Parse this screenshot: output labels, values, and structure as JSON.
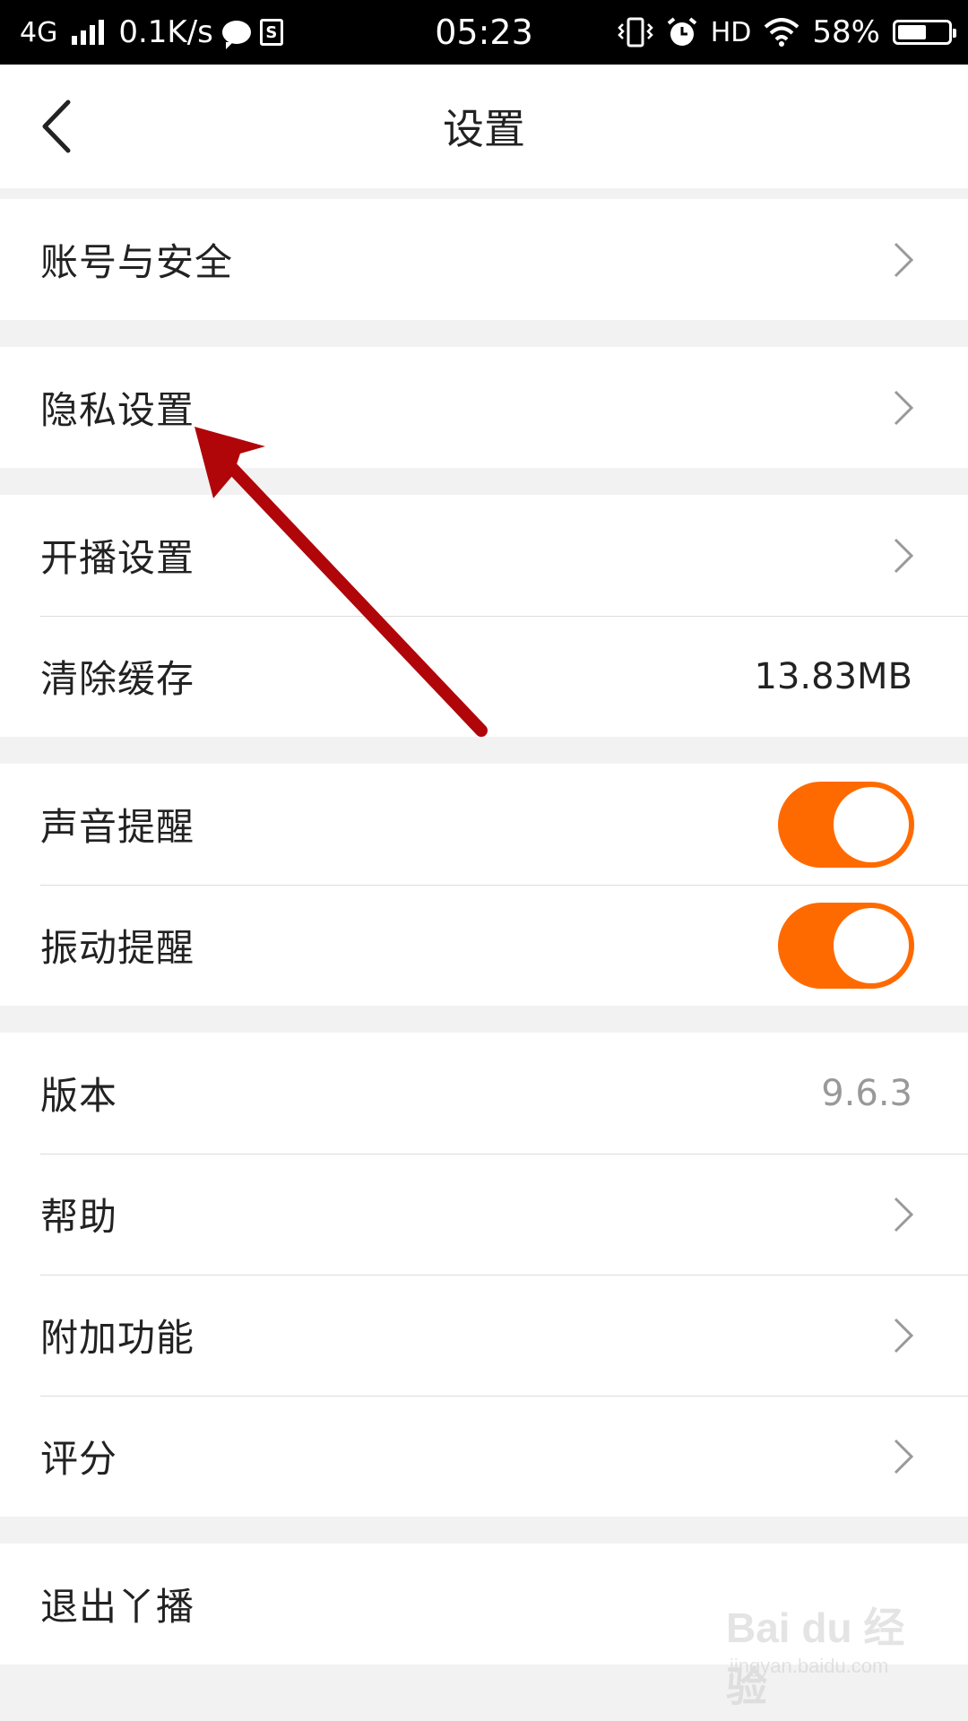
{
  "status_bar": {
    "network": "4G",
    "speed": "0.1K/s",
    "time": "05:23",
    "hd": "HD",
    "battery_percent": "58%",
    "battery_level": 0.58,
    "icons": [
      "signal-icon",
      "message-icon",
      "sim-icon",
      "vibrate-icon",
      "alarm-icon",
      "wifi-icon",
      "battery-icon"
    ]
  },
  "header": {
    "title": "设置"
  },
  "settings": {
    "account": {
      "label": "账号与安全"
    },
    "privacy": {
      "label": "隐私设置"
    },
    "broadcast": {
      "label": "开播设置"
    },
    "cache": {
      "label": "清除缓存",
      "value": "13.83MB"
    },
    "sound": {
      "label": "声音提醒",
      "enabled": true
    },
    "vibrate": {
      "label": "振动提醒",
      "enabled": true
    },
    "version": {
      "label": "版本",
      "value": "9.6.3"
    },
    "help": {
      "label": "帮助"
    },
    "addons": {
      "label": "附加功能"
    },
    "rate": {
      "label": "评分"
    },
    "logout": {
      "label": "退出丫播"
    }
  },
  "watermark": {
    "brand": "Bai du 经验",
    "url": "jingyan.baidu.com"
  },
  "colors": {
    "accent": "#ff6a00",
    "annotation_arrow": "#b0060a",
    "background": "#f2f2f2"
  }
}
